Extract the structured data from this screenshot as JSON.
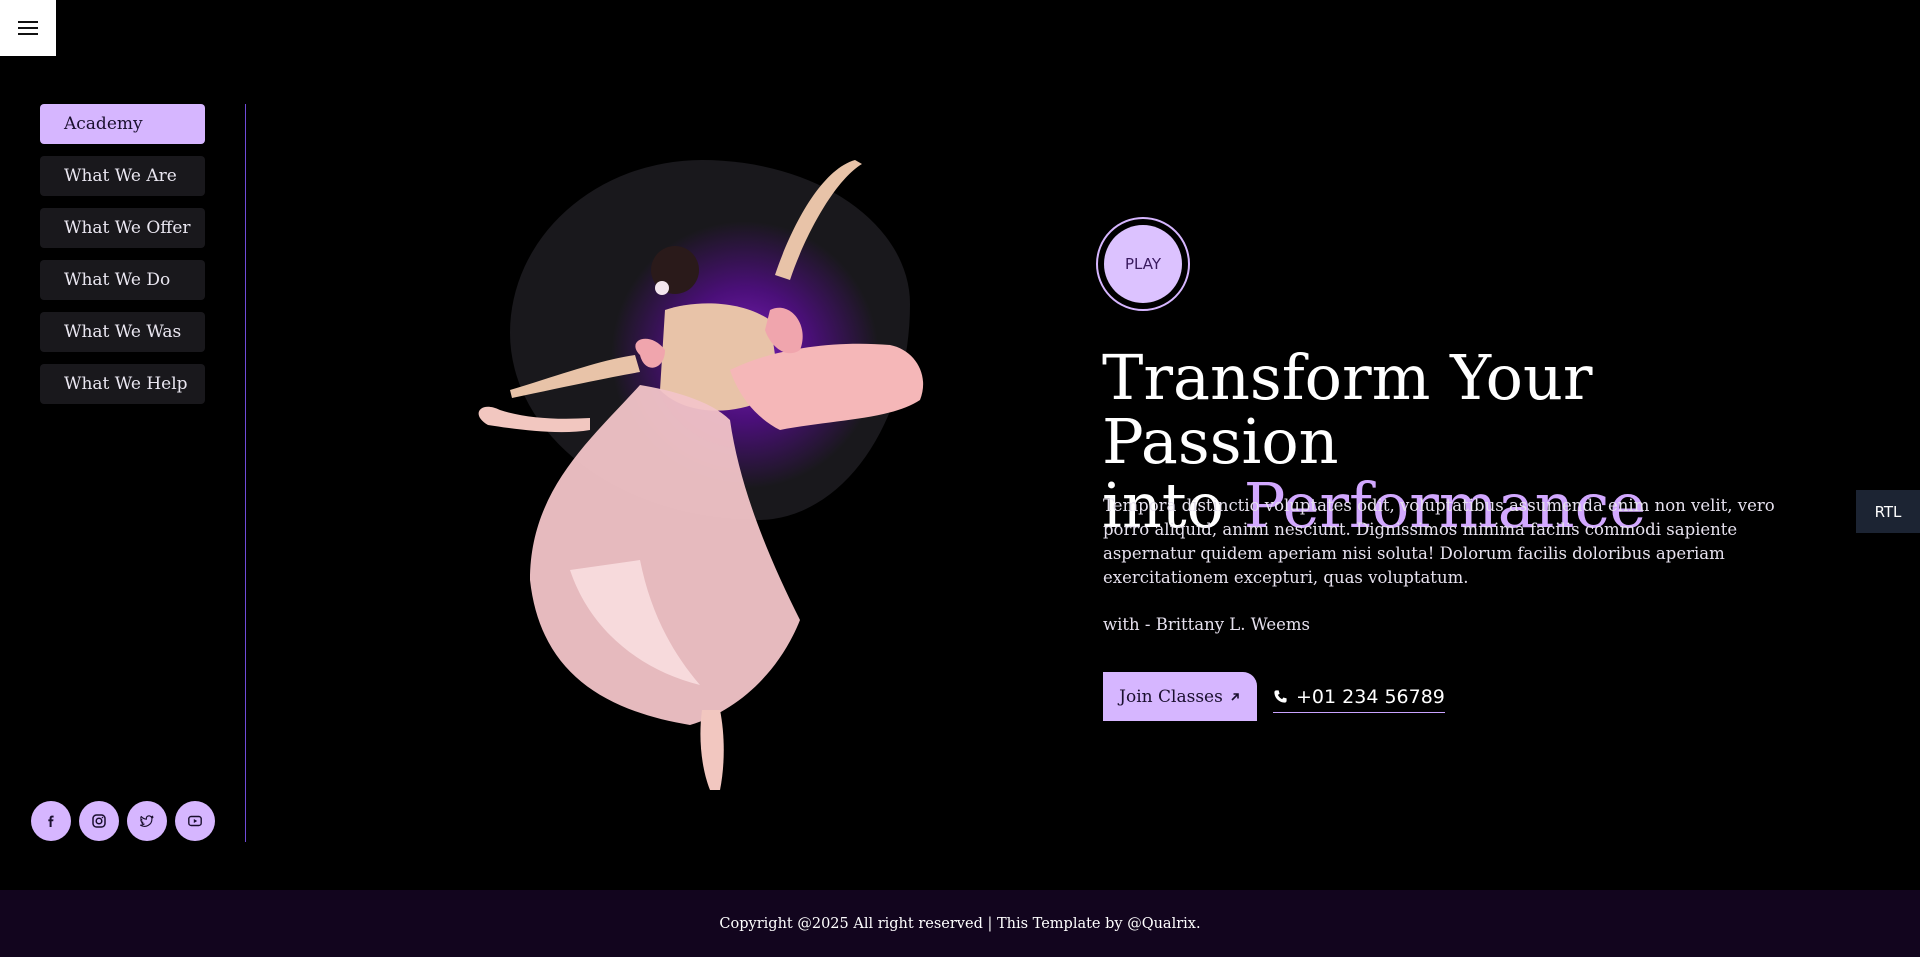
{
  "nav": {
    "menu_icon": "hamburger-menu-icon",
    "items": [
      {
        "label": "Academy",
        "active": true
      },
      {
        "label": "What We Are"
      },
      {
        "label": "What We Offer"
      },
      {
        "label": "What We Do"
      },
      {
        "label": "What We Was"
      },
      {
        "label": "What We Help"
      }
    ]
  },
  "social": [
    "facebook-icon",
    "instagram-icon",
    "twitter-icon",
    "youtube-icon"
  ],
  "hero": {
    "play_label": "PLAY",
    "title_line1": "Transform Your Passion",
    "title_line2_plain": "into",
    "title_line2_accent": "Performance",
    "description": "Tempora distinctio voluptates odit, voluptatibus assumenda enim non velit, vero porro aliquid, animi nesciunt. Dignissimos minima facilis commodi sapiente aspernatur quidem aperiam nisi soluta! Dolorum facilis doloribus aperiam exercitationem excepturi, quas voluptatum.",
    "byline": "with - Brittany L. Weems",
    "join_label": "Join Classes",
    "join_icon": "arrow-up-right-icon",
    "phone": "+01 234 56789",
    "phone_icon": "phone-icon"
  },
  "rtl_label": "RTL",
  "footer": {
    "copyright": "Copyright @2025 All right reserved | This Template by @Qualrix."
  },
  "colors": {
    "accent": "#d6b6ff",
    "background": "#000000",
    "footer_bg": "#12051e",
    "sidebar_item_bg": "#19181c"
  }
}
